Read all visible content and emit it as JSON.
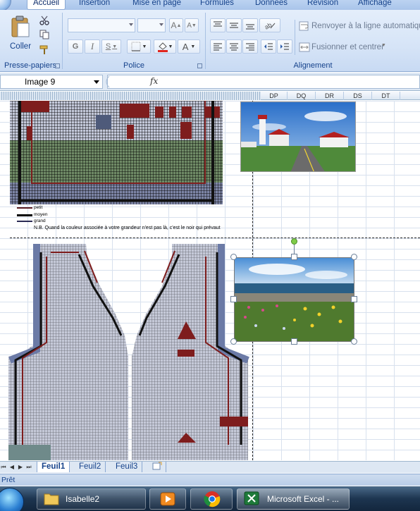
{
  "ribbon_tabs": [
    "Accueil",
    "Insertion",
    "Mise en page",
    "Formules",
    "Données",
    "Révision",
    "Affichage"
  ],
  "clipboard": {
    "paste_label": "Coller",
    "group_label": "Presse-papiers"
  },
  "font": {
    "group_label": "Police",
    "bold": "G",
    "italic": "I",
    "underline": "S",
    "grow": "A",
    "shrink": "A",
    "color_letter": "A"
  },
  "alignment": {
    "wrap_label": "Renvoyer à la ligne automatique",
    "merge_label": "Fusionner et centrer",
    "group_label": "Alignement"
  },
  "formula_bar": {
    "name_box": "Image 9",
    "fx_label": "fx"
  },
  "column_headers": [
    "DP",
    "DQ",
    "DR",
    "DS",
    "DT"
  ],
  "legend": {
    "items": [
      "petit",
      "moyen",
      "grand"
    ],
    "note": "N.B. Quand la couleur associée à votre grandeur n'est pas là, c'est le noir qui prévaut"
  },
  "sheet_tabs": [
    "Feuil1",
    "Feuil2",
    "Feuil3"
  ],
  "status": {
    "text": "Prêt"
  },
  "taskbar": {
    "items": [
      "Isabelle2",
      "Microsoft Excel - ..."
    ]
  },
  "colors": {
    "ribbon_text": "#15428b",
    "pattern_blue": "#6b7aa6",
    "pattern_red": "#7e1d1d",
    "pattern_green": "#5e7a5a"
  }
}
